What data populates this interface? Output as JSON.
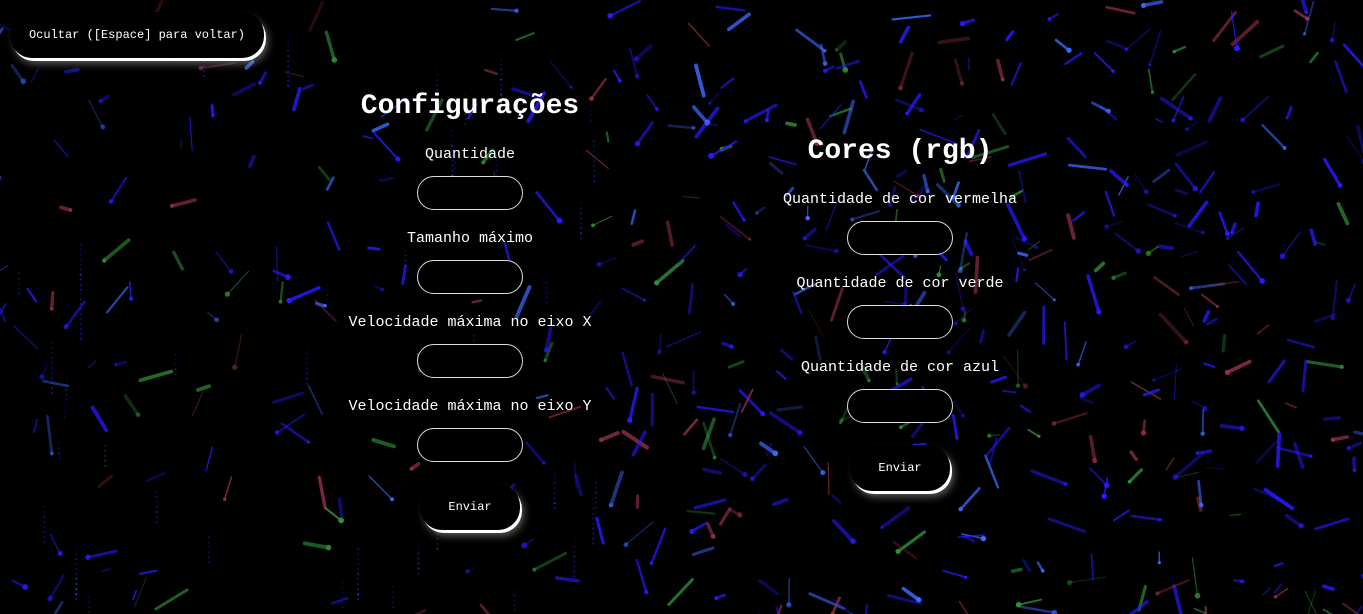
{
  "hide_button": {
    "label": "Ocultar ([Espace] para voltar)"
  },
  "config_panel": {
    "title": "Configurações",
    "fields": [
      {
        "label": "Quantidade",
        "value": ""
      },
      {
        "label": "Tamanho máximo",
        "value": ""
      },
      {
        "label": "Velocidade máxima no eixo X",
        "value": ""
      },
      {
        "label": "Velocidade máxima no eixo Y",
        "value": ""
      }
    ],
    "submit_label": "Enviar"
  },
  "colors_panel": {
    "title": "Cores (rgb)",
    "fields": [
      {
        "label": "Quantidade de cor vermelha",
        "value": ""
      },
      {
        "label": "Quantidade de cor verde",
        "value": ""
      },
      {
        "label": "Quantidade de cor azul",
        "value": ""
      }
    ],
    "submit_label": "Enviar"
  },
  "theme": {
    "background": "#000000",
    "particle_primary": "#2a1aff",
    "particle_secondary": "#3b6cff",
    "particle_accent_green": "#2f8f3a",
    "particle_accent_red": "#8f2f4a"
  }
}
